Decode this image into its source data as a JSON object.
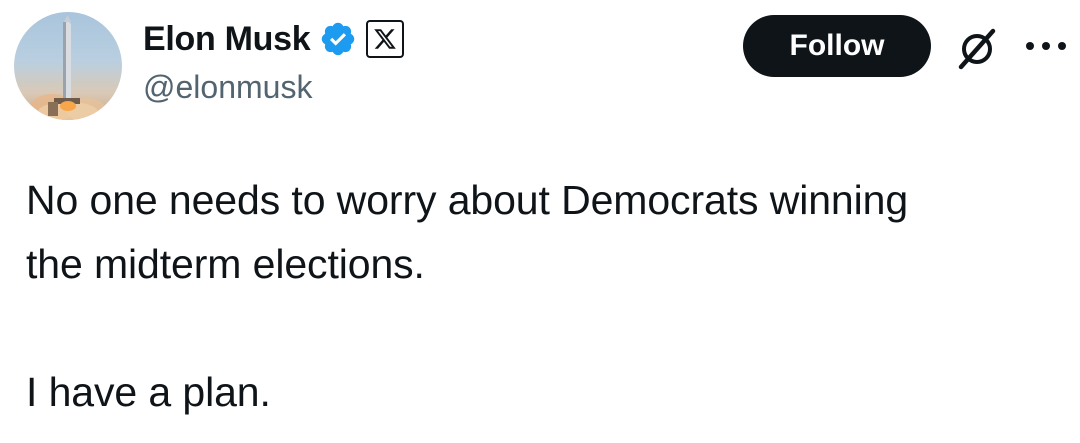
{
  "author": {
    "display_name": "Elon Musk",
    "handle": "@elonmusk",
    "verified_color": "#1d9bf0",
    "verified_icon": "verified-badge-icon",
    "affiliation_icon": "x-logo-icon",
    "avatar_icon": "rocket-launch-avatar"
  },
  "actions": {
    "follow_label": "Follow",
    "grok_icon": "grok-icon",
    "more_icon": "more-dots-icon"
  },
  "post": {
    "line_1": "No one needs to worry about Democrats winning",
    "line_2": "the midterm elections.",
    "line_3": "I have a plan."
  }
}
